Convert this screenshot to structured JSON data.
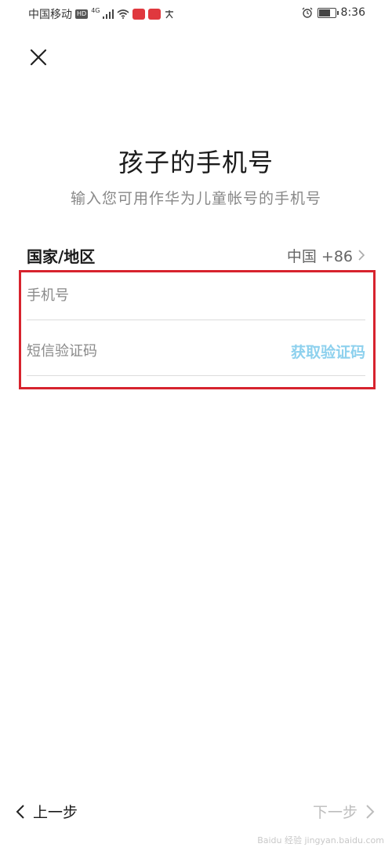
{
  "status_bar": {
    "carrier": "中国移动",
    "hd": "HD",
    "network": "4G",
    "time": "8:36",
    "battery_level": 0.65
  },
  "header": {
    "title": "孩子的手机号",
    "subtitle": "输入您可用作华为儿童帐号的手机号"
  },
  "country": {
    "label": "国家/地区",
    "value": "中国 +86"
  },
  "form": {
    "phone_placeholder": "手机号",
    "code_placeholder": "短信验证码",
    "get_code_label": "获取验证码"
  },
  "nav": {
    "prev_label": "上一步",
    "next_label": "下一步"
  },
  "watermark": "Baidu 经验  jingyan.baidu.com",
  "colors": {
    "highlight": "#d7232e",
    "link": "#8ed1ee"
  }
}
